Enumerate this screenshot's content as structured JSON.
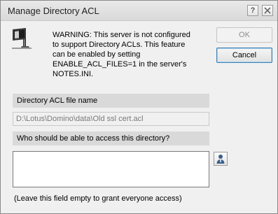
{
  "window": {
    "title": "Manage Directory ACL",
    "help_label": "?"
  },
  "warning": {
    "icon": "warning-sign-icon",
    "text": "WARNING: This server is not configured\nto support Directory ACLs. This feature\ncan be enabled by setting\nENABLE_ACL_FILES=1 in the server's\nNOTES.INI."
  },
  "buttons": {
    "ok_label": "OK",
    "cancel_label": "Cancel"
  },
  "acl_file": {
    "header": "Directory ACL file name",
    "value": "D:\\Lotus\\Domino\\data\\Old ssl cert.acl"
  },
  "access": {
    "header": "Who should be able to access this directory?",
    "value": "",
    "picker_icon": "address-book-person-icon",
    "hint": "(Leave this field empty to grant everyone access)"
  }
}
